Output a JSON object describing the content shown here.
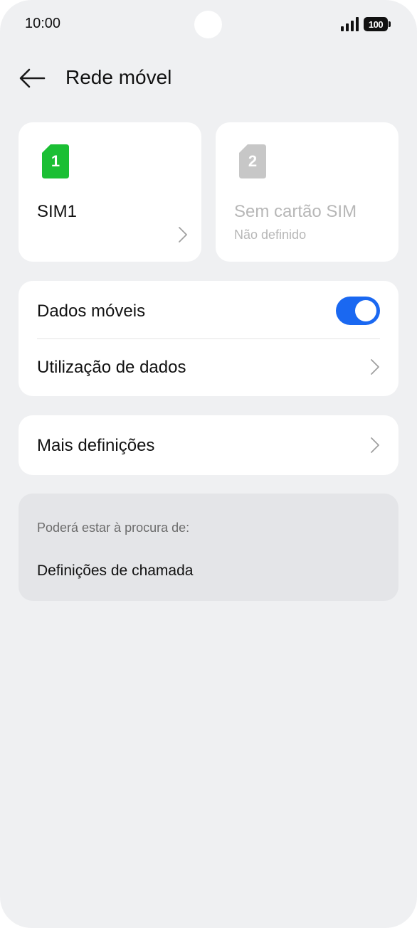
{
  "status_bar": {
    "time": "10:00",
    "battery_level": "100",
    "signal_icon": "signal-bars-icon"
  },
  "header": {
    "title": "Rede móvel",
    "back_icon": "arrow-left-icon"
  },
  "sims": [
    {
      "badge": "1",
      "name": "SIM1",
      "subtitle": "",
      "color": "#1bbf34",
      "enabled": true
    },
    {
      "badge": "2",
      "name": "Sem cartão SIM",
      "subtitle": "Não definido",
      "color": "#c7c7c7",
      "enabled": false
    }
  ],
  "data_card": {
    "mobile_data_label": "Dados móveis",
    "mobile_data_on": true,
    "data_usage_label": "Utilização de dados"
  },
  "more_card": {
    "label": "Mais definições"
  },
  "suggestions": {
    "title": "Poderá estar à procura de:",
    "items": [
      "Definições de chamada"
    ]
  },
  "colors": {
    "accent": "#1a68f1",
    "sim1": "#1bbf34",
    "background": "#eff0f2"
  }
}
